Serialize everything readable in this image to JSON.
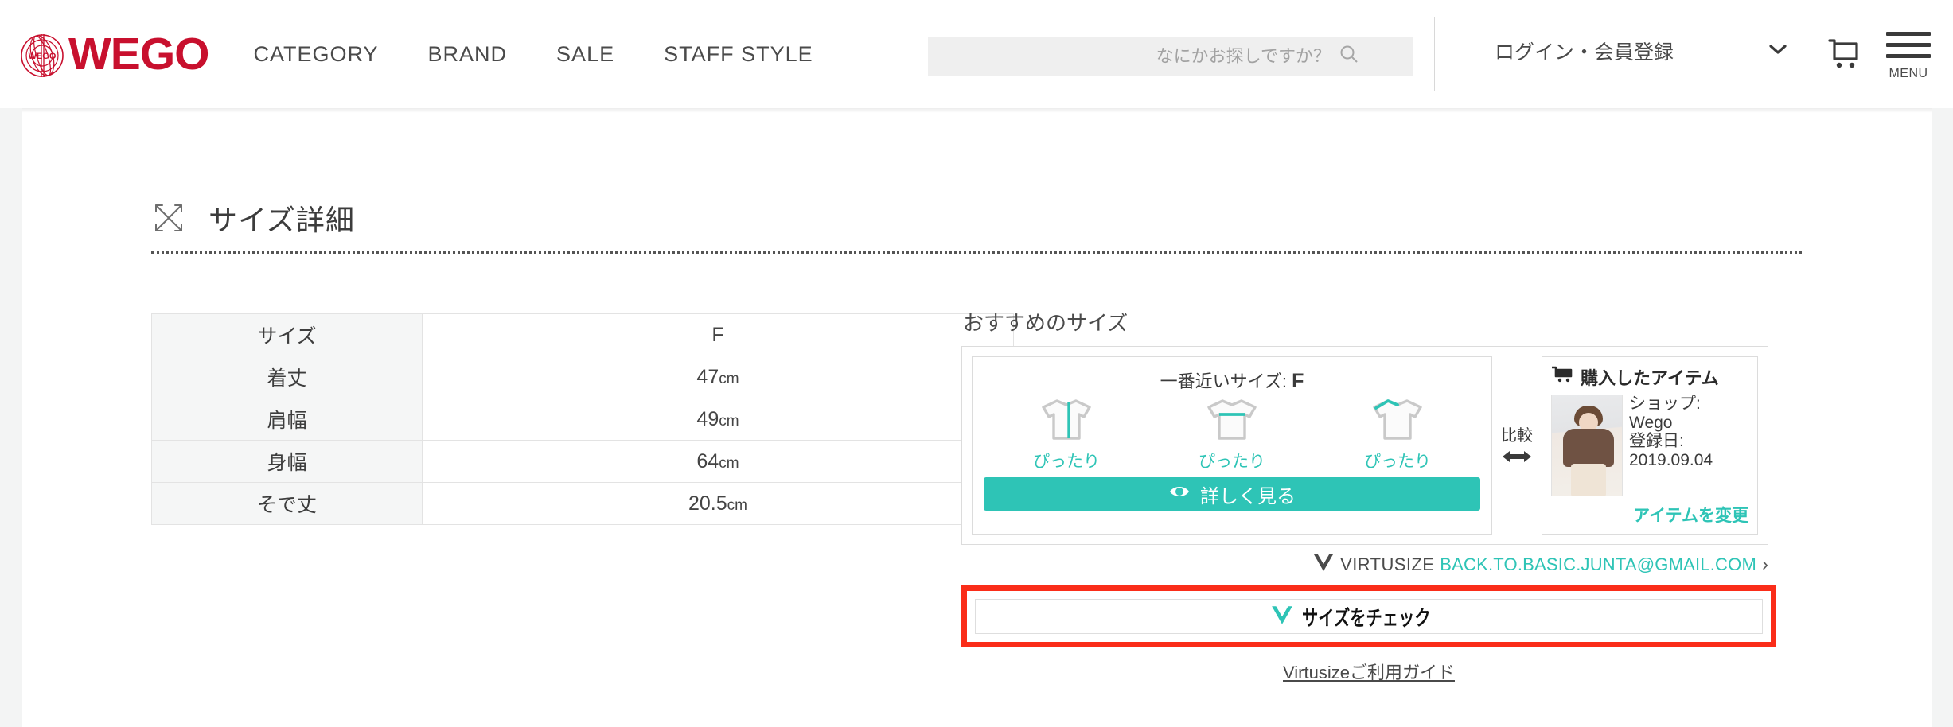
{
  "header": {
    "brand": "WEGO",
    "logo_mark_text": "WEGO",
    "nav": [
      {
        "label": "CATEGORY"
      },
      {
        "label": "BRAND"
      },
      {
        "label": "SALE"
      },
      {
        "label": "STAFF STYLE"
      }
    ],
    "search": {
      "value": "",
      "placeholder": "なにかお探しですか？",
      "icon": "search-icon"
    },
    "account": {
      "label": "ログイン・会員登録",
      "chevron_icon": "chevron-down-icon"
    },
    "cart_icon": "cart-icon",
    "menu_icon": "hamburger-icon",
    "menu_label": "MENU"
  },
  "page": {
    "title": "サイズ詳細",
    "title_icon": "resize-diagonal-icon"
  },
  "size_table": {
    "rows": [
      {
        "label": "サイズ",
        "value": "F",
        "unit": ""
      },
      {
        "label": "着丈",
        "value": "47",
        "unit": "cm"
      },
      {
        "label": "肩幅",
        "value": "49",
        "unit": "cm"
      },
      {
        "label": "身幅",
        "value": "64",
        "unit": "cm"
      },
      {
        "label": "そで丈",
        "value": "20.5",
        "unit": "cm"
      }
    ]
  },
  "virtusize": {
    "heading": "おすすめのサイズ",
    "best_size_prefix": "一番近いサイズ:",
    "best_size": "F",
    "fits": [
      {
        "label": "ぴったり",
        "icon": "tshirt-length-icon"
      },
      {
        "label": "ぴったり",
        "icon": "tshirt-width-icon"
      },
      {
        "label": "ぴったり",
        "icon": "tshirt-shoulder-icon"
      }
    ],
    "detail_button": {
      "label": "詳しく見る",
      "icon": "eye-icon"
    },
    "compare": {
      "label": "比較",
      "icon": "left-right-arrow-icon"
    },
    "purchased": {
      "title": "購入したアイテム",
      "title_icon": "cart-icon",
      "shop_label": "ショップ:",
      "shop_value": "Wego",
      "date_label": "登録日:",
      "date_value": "2019.09.04",
      "change_link": "アイテムを変更",
      "thumbnail_alt": "purchased-item-photo"
    },
    "account_row": {
      "brand": "VIRTUSIZE",
      "brand_icon": "virtusize-v-icon",
      "email": "BACK.TO.BASIC.JUNTA@GMAIL.COM",
      "chevron": "›"
    },
    "check_button": {
      "label": "サイズをチェック",
      "icon": "virtusize-v-icon"
    },
    "guide_link": "Virtusizeご利用ガイド"
  },
  "colors": {
    "brand_red": "#c8102e",
    "accent_teal": "#2ec4b6",
    "highlight_red": "#fa2d19",
    "text_dark": "#3c3c3c"
  }
}
